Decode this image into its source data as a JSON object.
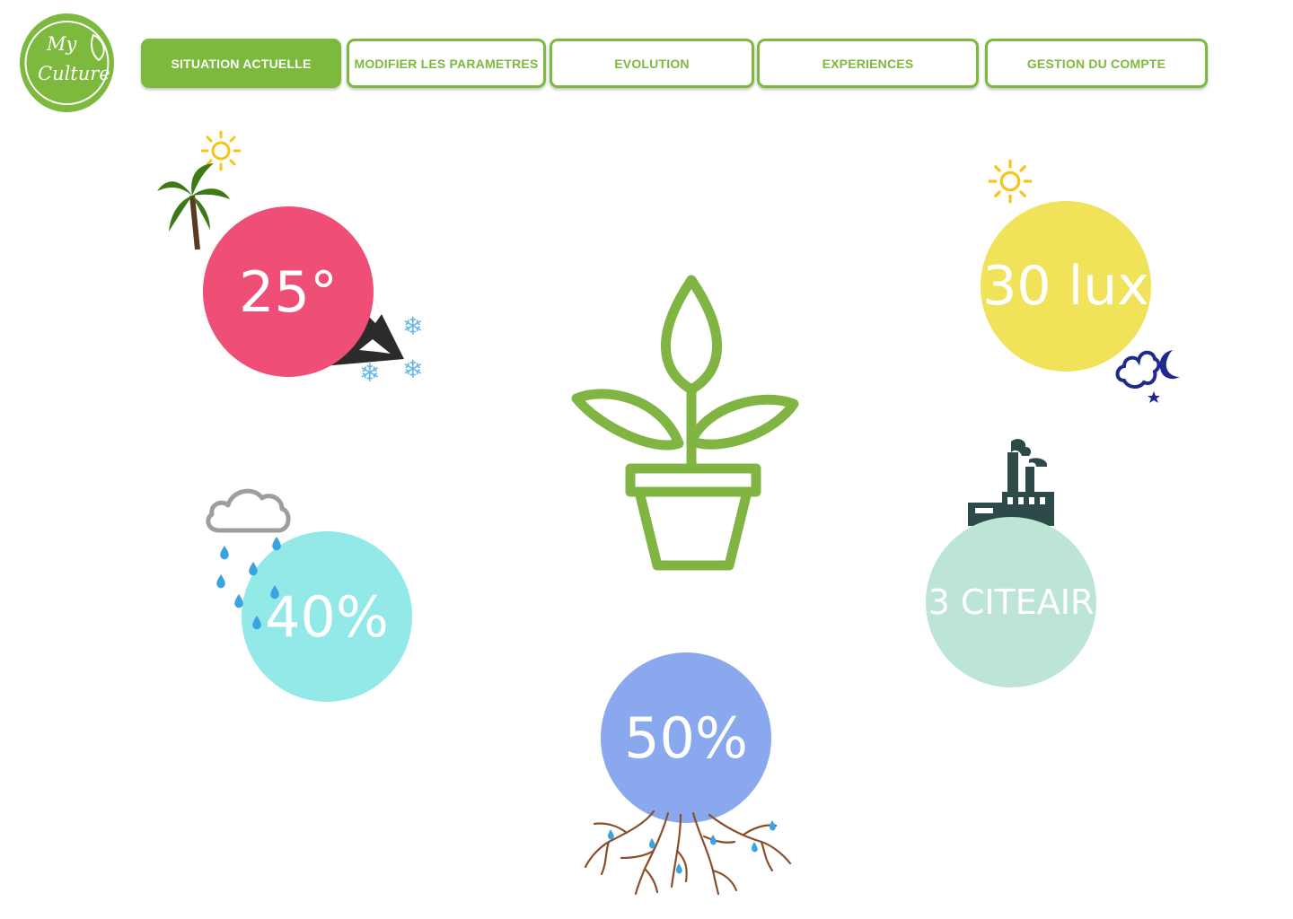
{
  "logo": {
    "line1": "My",
    "line2": "Culture",
    "color": "#7db93c"
  },
  "nav": {
    "items": [
      {
        "label": "SITUATION ACTUELLE",
        "active": true
      },
      {
        "label": "MODIFIER LES PARAMETRES",
        "active": false
      },
      {
        "label": "EVOLUTION",
        "active": false
      },
      {
        "label": "EXPERIENCES",
        "active": false
      },
      {
        "label": "GESTION DU COMPTE",
        "active": false
      }
    ]
  },
  "metrics": {
    "temperature": {
      "value": "25°",
      "color": "#ef4e76",
      "icons": [
        "sun-icon",
        "palm-tree-icon",
        "mountain-icon",
        "snowflake-icon"
      ]
    },
    "light": {
      "value": "30 lux",
      "color": "#f0e35a",
      "icons": [
        "sun-icon",
        "moon-cloud-icon"
      ]
    },
    "humidity": {
      "value": "40%",
      "color": "#93e9e7",
      "icons": [
        "rain-cloud-icon"
      ]
    },
    "air_quality": {
      "value": "3 CITEAIR",
      "color": "#bde5d6",
      "icons": [
        "factory-icon"
      ]
    },
    "soil_moisture": {
      "value": "50%",
      "color": "#8aa8ee",
      "icons": [
        "roots-icon"
      ]
    }
  },
  "center": {
    "icon": "plant-pot-icon",
    "color": "#80b544"
  }
}
